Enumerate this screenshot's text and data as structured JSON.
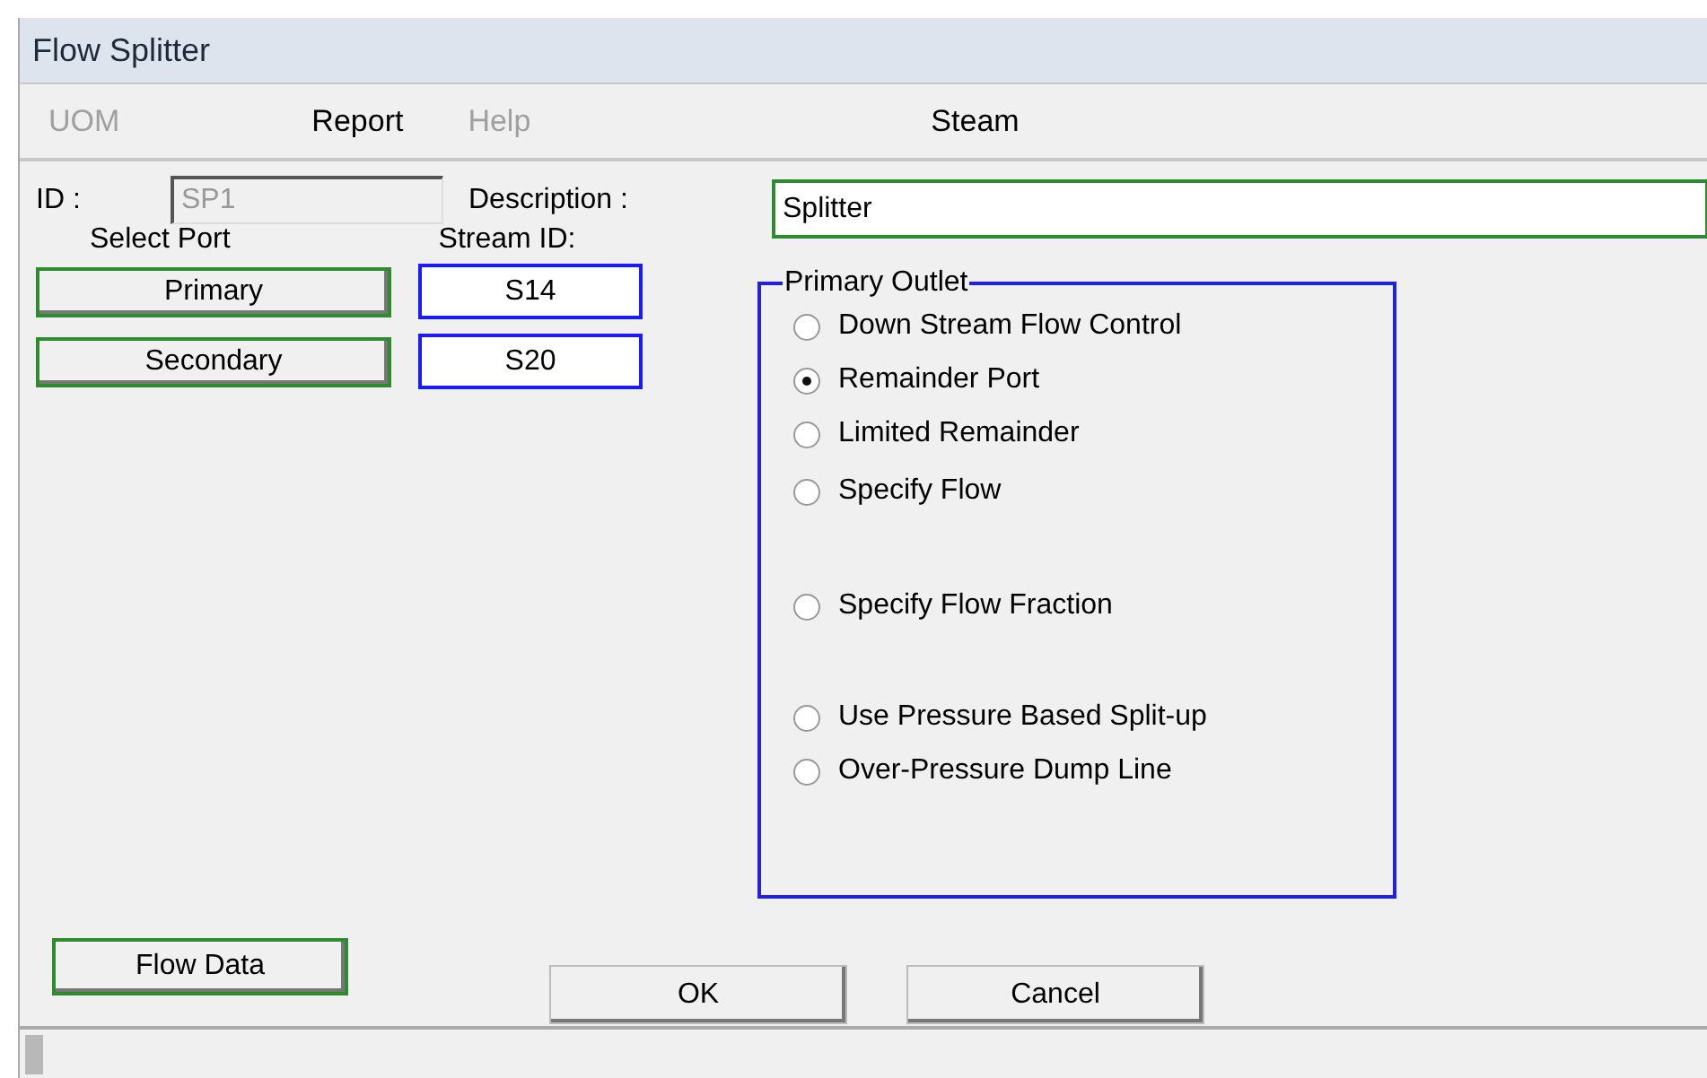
{
  "window": {
    "title": "Flow Splitter"
  },
  "menu": [
    {
      "label": "UOM",
      "disabled": true
    },
    {
      "label": "Report",
      "disabled": false
    },
    {
      "label": "Help",
      "disabled": true
    }
  ],
  "menu_caption": "Steam",
  "id_label": "ID :",
  "id_value": "SP1",
  "id_disabled": true,
  "description_label": "Description :",
  "description_value": "Splitter",
  "select_port_label": "Select Port",
  "stream_id_label": "Stream ID:",
  "ports": [
    {
      "button": "Primary",
      "stream": "S14"
    },
    {
      "button": "Secondary",
      "stream": "S20"
    }
  ],
  "primary_outlet": {
    "title": "Primary Outlet",
    "options": [
      {
        "label": "Down Stream Flow Control",
        "selected": false
      },
      {
        "label": "Remainder Port",
        "selected": true
      },
      {
        "label": "Limited Remainder",
        "selected": false
      },
      {
        "label": "Specify Flow",
        "selected": false
      },
      {
        "label": "Specify Flow Fraction",
        "selected": false
      },
      {
        "label": "Use Pressure Based Split-up",
        "selected": false
      },
      {
        "label": "Over-Pressure Dump Line",
        "selected": false
      }
    ]
  },
  "flow_data_button": "Flow Data",
  "buttons": [
    "OK",
    "Cancel"
  ]
}
